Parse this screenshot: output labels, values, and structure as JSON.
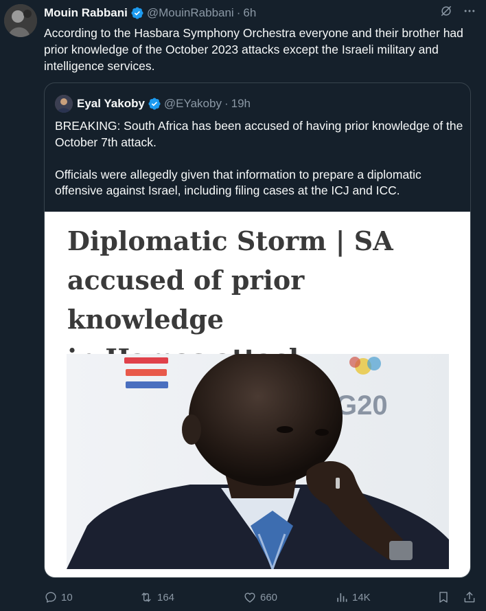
{
  "author": {
    "name": "Mouin Rabbani",
    "handle": "@MouinRabbani",
    "time": "6h"
  },
  "tweet_text": "According to the Hasbara Symphony Orchestra everyone and their brother had prior knowledge of the October 2023 attacks except the Israeli military and intelligence services.",
  "quoted": {
    "name": "Eyal Yakoby",
    "handle": "@EYakoby",
    "time": "19h",
    "paragraph_1": "BREAKING: South Africa has been accused of having prior knowledge of the October 7th attack.",
    "paragraph_2": "Officials were allegedly given that information to prepare a diplomatic offensive against Israel, including filing cases at the ICJ and ICC.",
    "media": {
      "headline_line_1": "Diplomatic Storm | SA",
      "headline_line_2": "accused of prior knowledge",
      "headline_line_3": "in Hamas attack",
      "photo_sign_text": "G20"
    }
  },
  "metrics": {
    "replies": "10",
    "reposts": "164",
    "likes": "660",
    "views": "14K"
  },
  "icons": {
    "verified": "verified-badge-icon",
    "grok": "grok-icon",
    "more": "more-icon",
    "reply": "reply-icon",
    "repost": "repost-icon",
    "like": "like-icon",
    "views": "views-icon",
    "bookmark": "bookmark-icon",
    "share": "share-icon"
  },
  "colors": {
    "background": "#15202b",
    "text": "#f7f9f9",
    "muted": "#8b98a5",
    "verified": "#1d9bf0",
    "border": "#38444d"
  }
}
